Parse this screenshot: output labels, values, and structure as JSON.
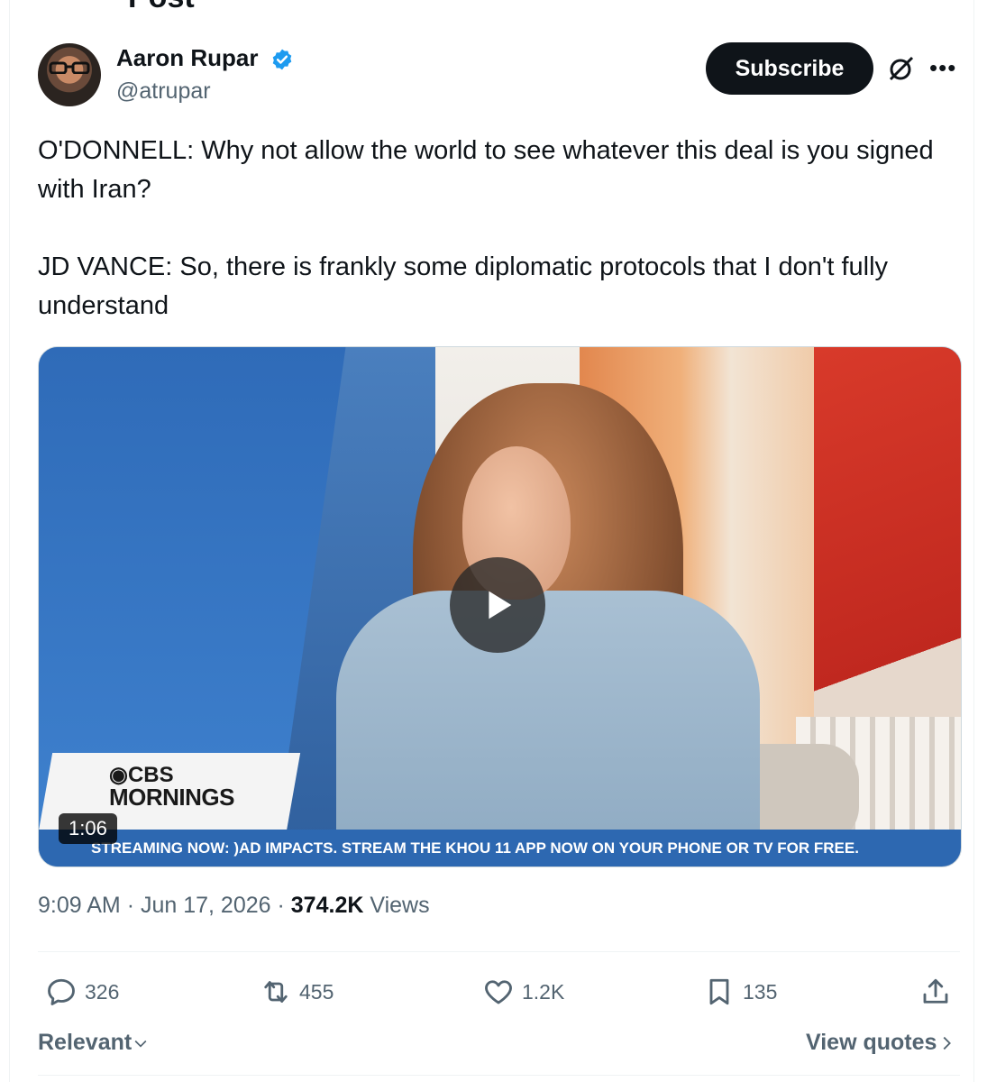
{
  "header": {
    "title": "Post"
  },
  "author": {
    "name": "Aaron Rupar",
    "handle": "@atrupar",
    "verified": true
  },
  "subscribe_label": "Subscribe",
  "tweet": {
    "text": "O'DONNELL: Why not allow the world to see whatever this deal is you signed with Iran?\n\nJD VANCE: So, there is frankly some diplomatic protocols that I don't fully understand"
  },
  "media": {
    "duration": "1:06",
    "logo_line1": "CBS",
    "logo_line2": "MORNINGS",
    "ticker": "STREAMING NOW: )AD IMPACTS. STREAM THE KHOU 11 APP NOW ON YOUR PHONE OR TV FOR FREE."
  },
  "meta": {
    "time": "9:09 AM",
    "date": "Jun 17, 2026",
    "views_count": "374.2K",
    "views_label": "Views"
  },
  "actions": {
    "replies": "326",
    "reposts": "455",
    "likes": "1.2K",
    "bookmarks": "135"
  },
  "footer": {
    "sort_label": "Relevant",
    "view_quotes": "View quotes"
  },
  "colors": {
    "text": "#0f1419",
    "muted": "#536471",
    "verified": "#1d9bf0",
    "ticker": "#2d68b1"
  }
}
